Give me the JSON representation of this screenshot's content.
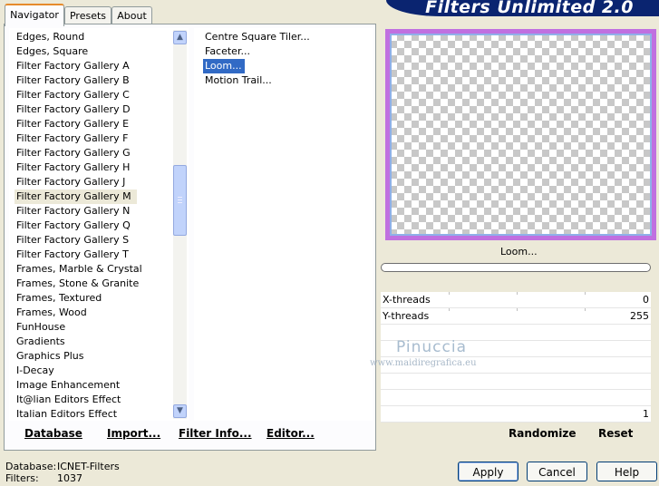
{
  "app_title": "Filters Unlimited 2.0",
  "tabs": [
    "Navigator",
    "Presets",
    "About"
  ],
  "categories": [
    "Edges, Round",
    "Edges, Square",
    "Filter Factory Gallery A",
    "Filter Factory Gallery B",
    "Filter Factory Gallery C",
    "Filter Factory Gallery D",
    "Filter Factory Gallery E",
    "Filter Factory Gallery F",
    "Filter Factory Gallery G",
    "Filter Factory Gallery H",
    "Filter Factory Gallery J",
    "Filter Factory Gallery M",
    "Filter Factory Gallery N",
    "Filter Factory Gallery Q",
    "Filter Factory Gallery S",
    "Filter Factory Gallery T",
    "Frames, Marble & Crystal",
    "Frames, Stone & Granite",
    "Frames, Textured",
    "Frames, Wood",
    "FunHouse",
    "Gradients",
    "Graphics Plus",
    "I-Decay",
    "Image Enhancement",
    "It@lian Editors Effect",
    "Italian Editors Effect"
  ],
  "selected_category": "Filter Factory Gallery M",
  "filters": [
    "Centre Square Tiler...",
    "Faceter...",
    "Loom...",
    "Motion Trail..."
  ],
  "selected_filter": "Loom...",
  "preview_label": "Loom...",
  "params": [
    {
      "label": "X-threads",
      "value": "0"
    },
    {
      "label": "Y-threads",
      "value": "255"
    }
  ],
  "bottom_value": "1",
  "watermark": {
    "name": "Pinuccia",
    "url": "www.maidiregrafica.eu"
  },
  "buttons": {
    "database": "Database",
    "import": "Import...",
    "filter_info": "Filter Info...",
    "editor": "Editor...",
    "randomize": "Randomize",
    "reset": "Reset",
    "apply": "Apply",
    "cancel": "Cancel",
    "help": "Help"
  },
  "status": {
    "database_label": "Database:",
    "database_value": "ICNET-Filters",
    "filters_label": "Filters:",
    "filters_value": "1037"
  },
  "colors": {
    "selection": "#316ac5",
    "banner": "#0a2470",
    "preview_border": "#c070e0"
  }
}
